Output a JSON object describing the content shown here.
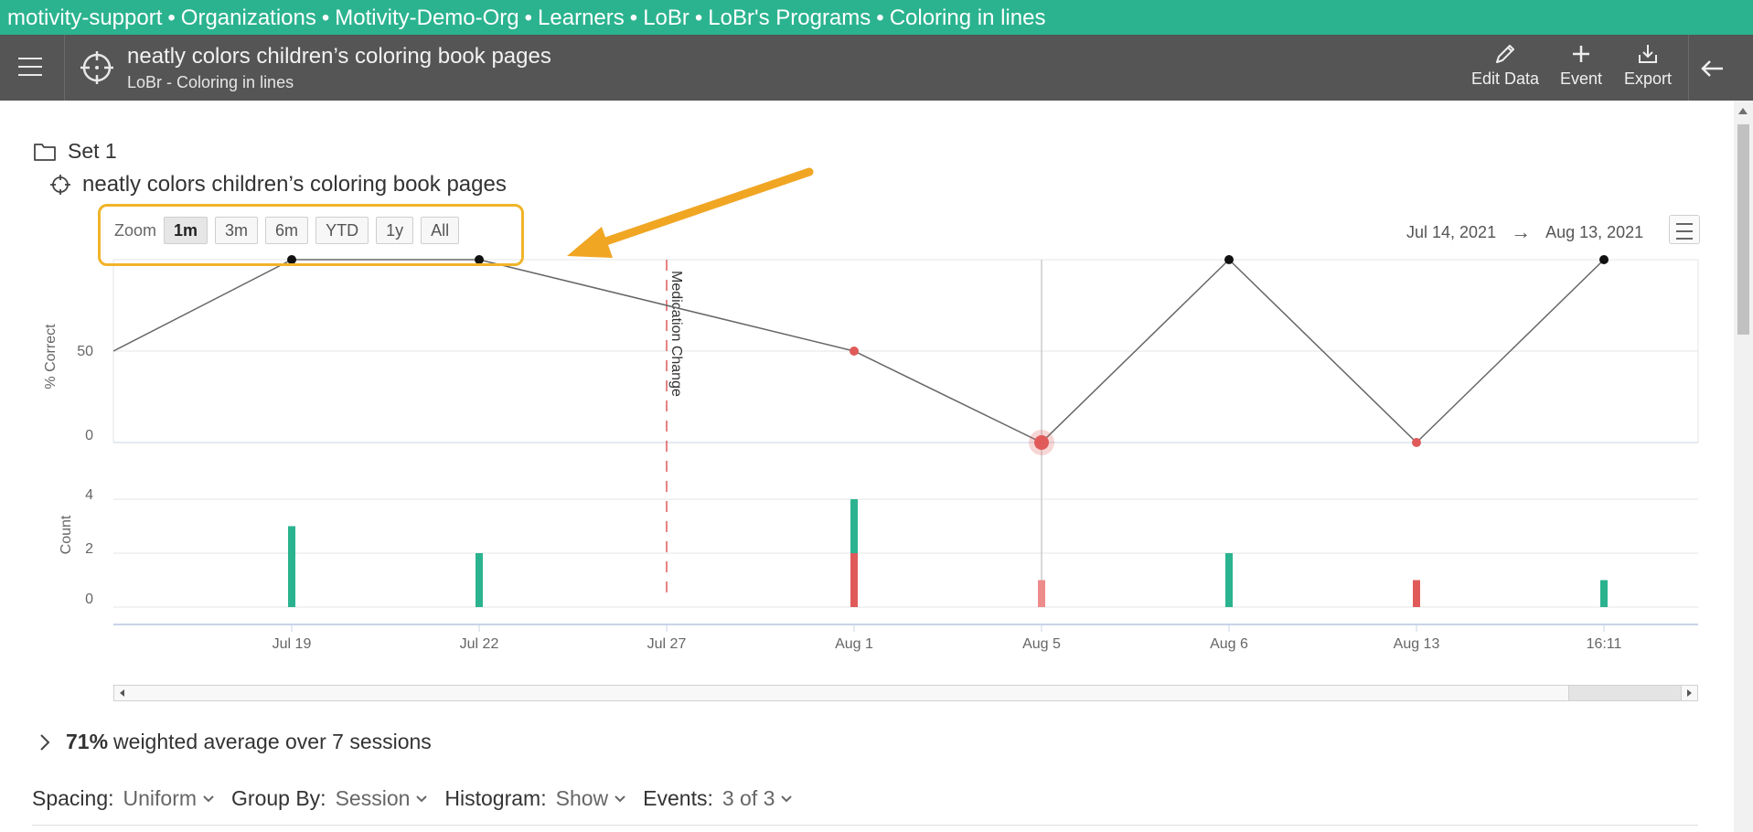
{
  "breadcrumb": [
    "motivity-support",
    "Organizations",
    "Motivity-Demo-Org",
    "Learners",
    "LoBr",
    "LoBr's Programs",
    "Coloring in lines"
  ],
  "breadcrumb_separator": "•",
  "header": {
    "title": "neatly colors children’s coloring book pages",
    "subtitle": "LoBr - Coloring in lines",
    "actions": [
      {
        "label": "Edit Data",
        "icon": "pencil-icon"
      },
      {
        "label": "Event",
        "icon": "plus-icon"
      },
      {
        "label": "Export",
        "icon": "download-icon"
      }
    ]
  },
  "set_label": "Set 1",
  "goal_label": "neatly colors children’s coloring book pages",
  "zoom": {
    "label": "Zoom",
    "options": [
      "1m",
      "3m",
      "6m",
      "YTD",
      "1y",
      "All"
    ],
    "active": "1m"
  },
  "range": {
    "start": "Jul 14, 2021",
    "arrow": "→",
    "end": "Aug 13, 2021"
  },
  "colors": {
    "brand": "#2bb38f",
    "header": "#555555",
    "correct": "#2bb38f",
    "incorrect": "#e05a5a",
    "highlight": "#f0b429"
  },
  "chart_data": {
    "type": "line",
    "categories": [
      "Jul 19",
      "Jul 22",
      "Jul 27",
      "Aug 1",
      "Aug 5",
      "Aug 6",
      "Aug 13",
      "16:11"
    ],
    "percent_series": {
      "ylabel": "% Correct",
      "yticks": [
        "50",
        "0"
      ],
      "points": [
        {
          "x": "Jul 19",
          "y": 100,
          "flag": "normal"
        },
        {
          "x": "Jul 22",
          "y": 100,
          "flag": "normal"
        },
        {
          "x": "Aug 1",
          "y": 50,
          "flag": "low"
        },
        {
          "x": "Aug 5",
          "y": 0,
          "flag": "selected"
        },
        {
          "x": "Aug 6",
          "y": 100,
          "flag": "normal"
        },
        {
          "x": "Aug 13",
          "y": 0,
          "flag": "low"
        },
        {
          "x": "16:11",
          "y": 100,
          "flag": "normal"
        }
      ],
      "start_value": 50,
      "ylim": [
        0,
        100
      ]
    },
    "count_series": {
      "ylabel": "Count",
      "yticks": [
        "4",
        "2",
        "0"
      ],
      "ylim": [
        0,
        4
      ],
      "bars": [
        {
          "x": "Jul 19",
          "correct": 3,
          "incorrect": 0
        },
        {
          "x": "Jul 22",
          "correct": 2,
          "incorrect": 0
        },
        {
          "x": "Aug 1",
          "correct": 2,
          "incorrect": 2
        },
        {
          "x": "Aug 5",
          "correct": 0,
          "incorrect": 1
        },
        {
          "x": "Aug 6",
          "correct": 2,
          "incorrect": 0
        },
        {
          "x": "Aug 13",
          "correct": 0,
          "incorrect": 1
        },
        {
          "x": "16:11",
          "correct": 1,
          "incorrect": 0
        }
      ]
    },
    "event": {
      "x": "Jul 27",
      "label": "Medication Change"
    }
  },
  "summary": {
    "percent": "71%",
    "text": "weighted average over 7 sessions"
  },
  "options": [
    {
      "label": "Spacing:",
      "value": "Uniform"
    },
    {
      "label": "Group By:",
      "value": "Session"
    },
    {
      "label": "Histogram:",
      "value": "Show"
    },
    {
      "label": "Events:",
      "value": "3 of 3"
    }
  ]
}
